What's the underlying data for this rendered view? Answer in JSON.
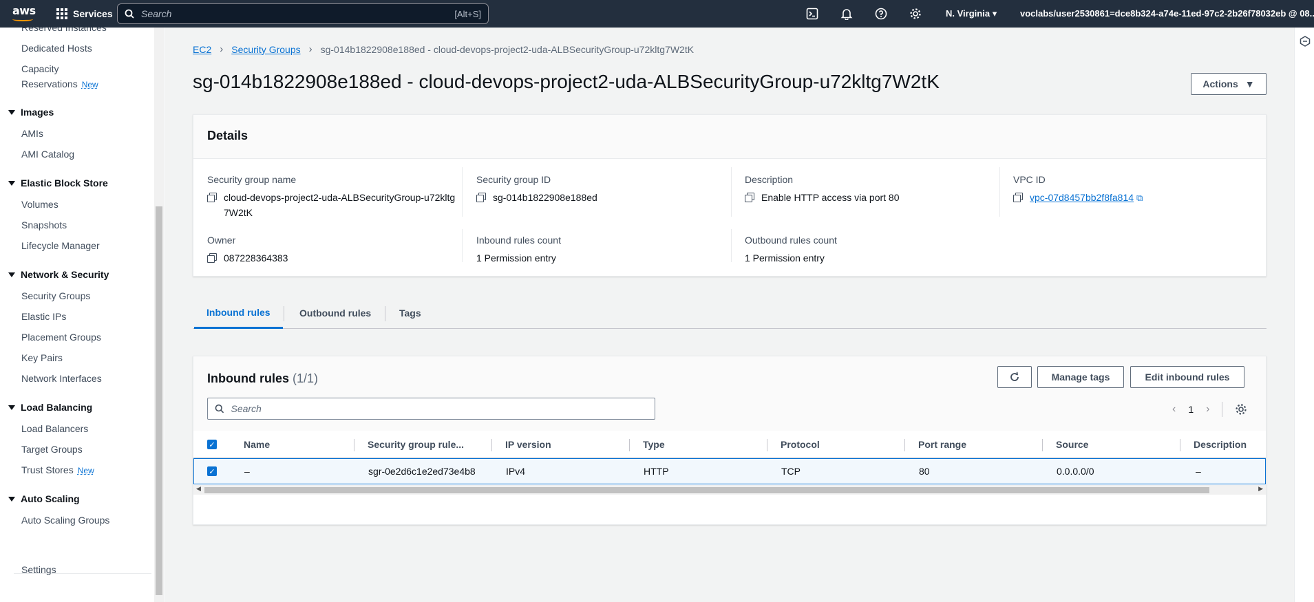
{
  "topbar": {
    "logo": "aws",
    "services": "Services",
    "search_placeholder": "Search",
    "search_shortcut": "[Alt+S]",
    "region": "N. Virginia",
    "account": "voclabs/user2530861=dce8b324-a74e-11ed-97c2-2b26f78032eb @ 08..."
  },
  "sidebar": {
    "top_item": "Reserved Instances",
    "dedicated_hosts": "Dedicated Hosts",
    "capacity": "Capacity",
    "reservations": "Reservations",
    "new": "New",
    "images": "Images",
    "amis": "AMIs",
    "ami_catalog": "AMI Catalog",
    "ebs": "Elastic Block Store",
    "volumes": "Volumes",
    "snapshots": "Snapshots",
    "lifecycle": "Lifecycle Manager",
    "network_security": "Network & Security",
    "security_groups": "Security Groups",
    "elastic_ips": "Elastic IPs",
    "placement_groups": "Placement Groups",
    "key_pairs": "Key Pairs",
    "network_interfaces": "Network Interfaces",
    "load_balancing": "Load Balancing",
    "load_balancers": "Load Balancers",
    "target_groups": "Target Groups",
    "trust_stores": "Trust Stores",
    "auto_scaling": "Auto Scaling",
    "auto_scaling_groups": "Auto Scaling Groups",
    "settings": "Settings"
  },
  "breadcrumb": {
    "ec2": "EC2",
    "security_groups": "Security Groups",
    "current": "sg-014b1822908e188ed - cloud-devops-project2-uda-ALBSecurityGroup-u72kltg7W2tK"
  },
  "page": {
    "title": "sg-014b1822908e188ed - cloud-devops-project2-uda-ALBSecurityGroup-u72kltg7W2tK",
    "actions": "Actions"
  },
  "details": {
    "title": "Details",
    "sg_name_label": "Security group name",
    "sg_name_value": "cloud-devops-project2-uda-ALBSecurityGroup-u72kltg7W2tK",
    "sg_id_label": "Security group ID",
    "sg_id_value": "sg-014b1822908e188ed",
    "description_label": "Description",
    "description_value": "Enable HTTP access via port 80",
    "vpc_label": "VPC ID",
    "vpc_value": "vpc-07d8457bb2f8fa814",
    "owner_label": "Owner",
    "owner_value": "087228364383",
    "inbound_count_label": "Inbound rules count",
    "inbound_count_value": "1 Permission entry",
    "outbound_count_label": "Outbound rules count",
    "outbound_count_value": "1 Permission entry"
  },
  "tabs": {
    "inbound": "Inbound rules",
    "outbound": "Outbound rules",
    "tags": "Tags"
  },
  "inbound": {
    "title": "Inbound rules",
    "count": "(1/1)",
    "manage_tags": "Manage tags",
    "edit": "Edit inbound rules",
    "search_placeholder": "Search",
    "page": "1",
    "columns": [
      "Name",
      "Security group rule...",
      "IP version",
      "Type",
      "Protocol",
      "Port range",
      "Source",
      "Description"
    ],
    "rows": [
      [
        "–",
        "sgr-0e2d6c1e2ed73e4b8",
        "IPv4",
        "HTTP",
        "TCP",
        "80",
        "0.0.0.0/0",
        "–"
      ]
    ]
  }
}
